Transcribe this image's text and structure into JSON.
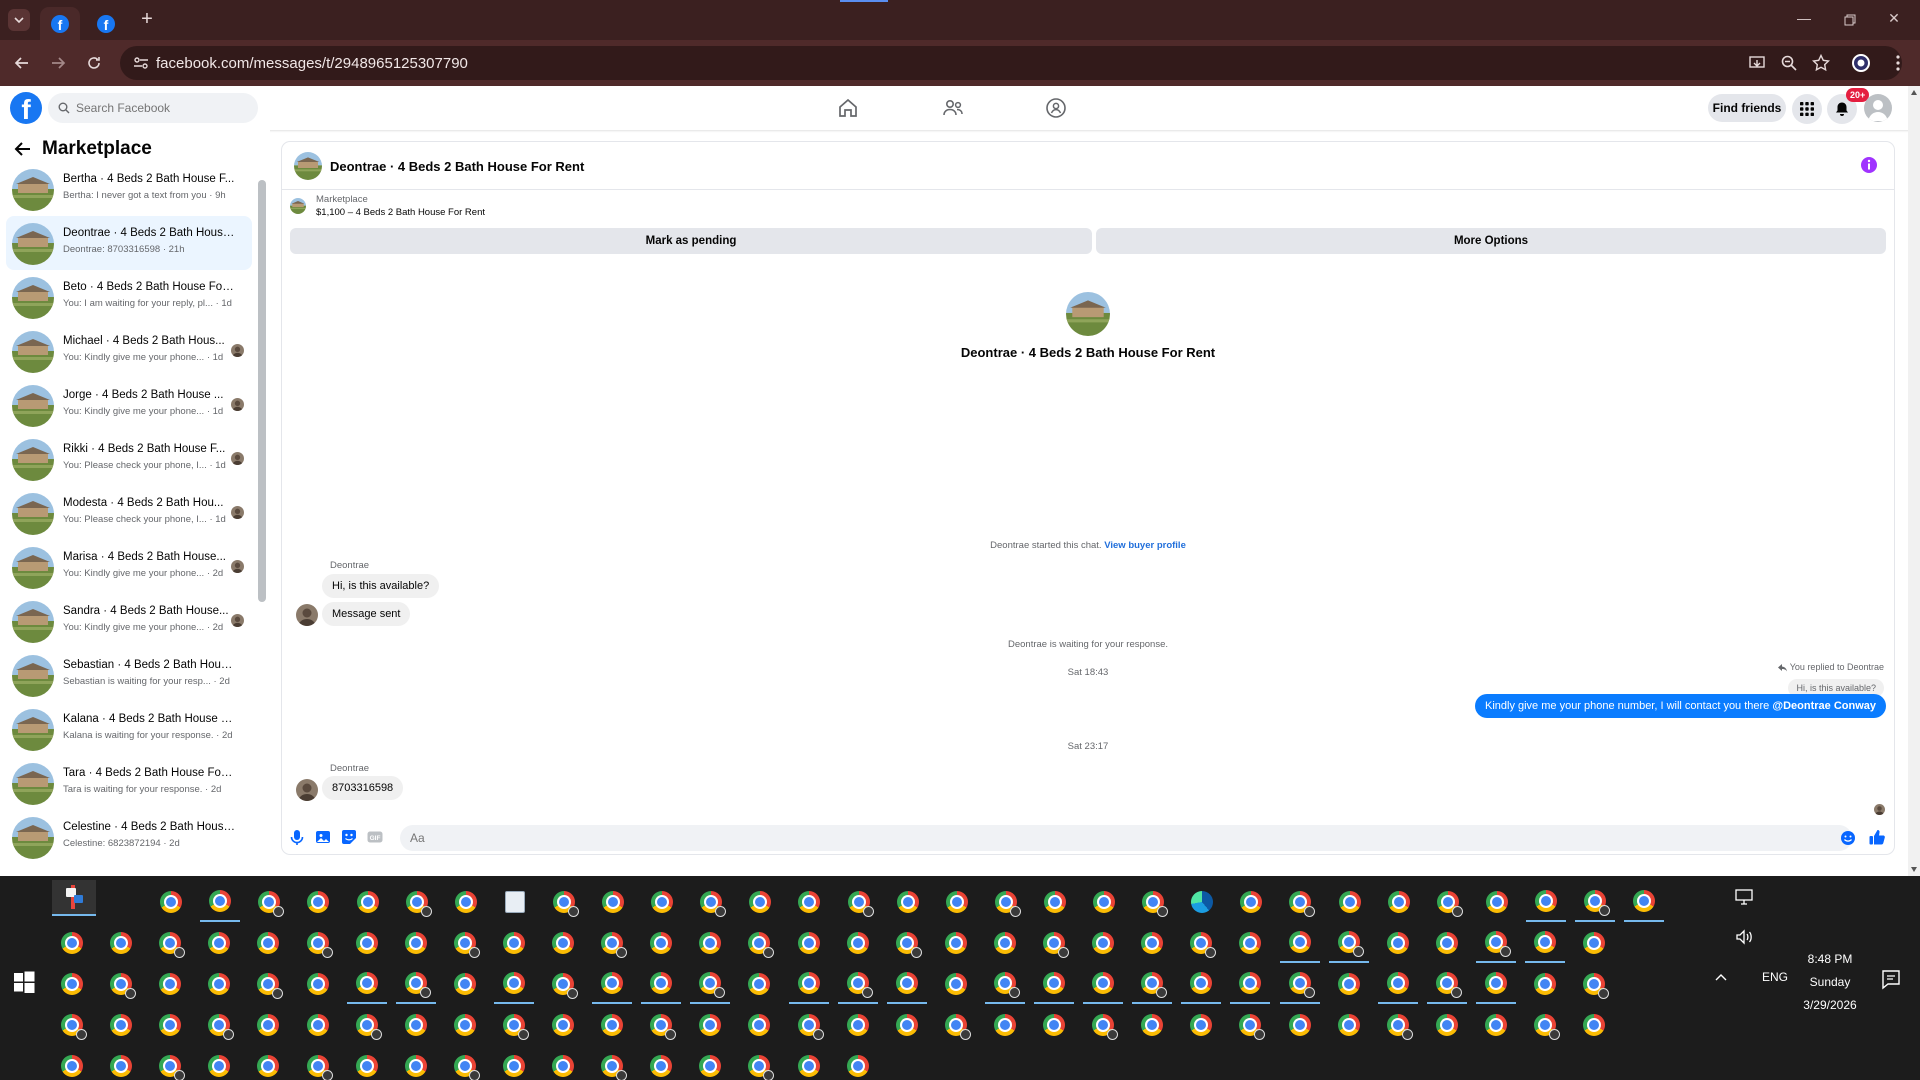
{
  "browser": {
    "url": "facebook.com/messages/t/2948965125307790",
    "tabs": [
      {
        "icon": "facebook-icon"
      },
      {
        "icon": "facebook-icon"
      }
    ]
  },
  "header": {
    "search_placeholder": "Search Facebook",
    "find_friends": "Find friends",
    "notification_badge": "20+"
  },
  "sidebar": {
    "title": "Marketplace",
    "conversations": [
      {
        "name": "Bertha · 4 Beds 2 Bath House F...",
        "preview": "Bertha: I never got a text from you · 9h",
        "active": false,
        "seen": false
      },
      {
        "name": "Deontrae · 4 Beds 2 Bath House...",
        "preview": "Deontrae: 8703316598 · 21h",
        "active": true,
        "seen": false
      },
      {
        "name": "Beto · 4 Beds 2 Bath House For ...",
        "preview": "You: I am waiting for your reply, pl... · 1d",
        "active": false,
        "seen": false
      },
      {
        "name": "Michael · 4 Beds 2 Bath Hous...",
        "preview": "You: Kindly give me your phone... · 1d",
        "active": false,
        "seen": true
      },
      {
        "name": "Jorge · 4 Beds 2 Bath House ...",
        "preview": "You: Kindly give me your phone... · 1d",
        "active": false,
        "seen": true
      },
      {
        "name": "Rikki · 4 Beds 2 Bath House F...",
        "preview": "You: Please check your phone, I... · 1d",
        "active": false,
        "seen": true
      },
      {
        "name": "Modesta · 4 Beds 2 Bath Hou...",
        "preview": "You: Please check your phone, I... · 1d",
        "active": false,
        "seen": true
      },
      {
        "name": "Marisa · 4 Beds 2 Bath House...",
        "preview": "You: Kindly give me your phone... · 2d",
        "active": false,
        "seen": true
      },
      {
        "name": "Sandra · 4 Beds 2 Bath House...",
        "preview": "You: Kindly give me your phone... · 2d",
        "active": false,
        "seen": true
      },
      {
        "name": "Sebastian · 4 Beds 2 Bath Hous...",
        "preview": "Sebastian is waiting for your resp... · 2d",
        "active": false,
        "seen": false
      },
      {
        "name": "Kalana · 4 Beds 2 Bath House F...",
        "preview": "Kalana is waiting for your response. · 2d",
        "active": false,
        "seen": false
      },
      {
        "name": "Tara · 4 Beds 2 Bath House For ...",
        "preview": "Tara is waiting for your response. · 2d",
        "active": false,
        "seen": false
      },
      {
        "name": "Celestine · 4 Beds 2 Bath House...",
        "preview": "Celestine: 6823872194 · 2d",
        "active": false,
        "seen": false
      }
    ]
  },
  "chat": {
    "title": "Deontrae · 4 Beds 2 Bath House For Rent",
    "marketplace_label": "Marketplace",
    "listing": "$1,100 – 4 Beds 2 Bath House For Rent",
    "mark_pending": "Mark as pending",
    "more_options": "More Options",
    "started_text": "Deontrae started this chat.",
    "view_profile": "View buyer profile",
    "sender_name": "Deontrae",
    "msg1": "Hi, is this available?",
    "msg2": "Message sent",
    "waiting_text": "Deontrae is waiting for your response.",
    "time1": "Sat 18:43",
    "replied_label": "You replied to Deontrae",
    "quoted_text": "Hi, is this available?",
    "my_message": "Kindly give me your phone number, I will contact you there ",
    "mention": "@Deontrae Conway",
    "time2": "Sat 23:17",
    "msg3": "8703316598",
    "composer_placeholder": "Aa"
  },
  "taskbar": {
    "language": "ENG",
    "time": "8:48 PM",
    "day": "Sunday",
    "date": "3/29/2026"
  },
  "colors": {
    "facebook_blue": "#1877f2",
    "message_blue": "#0a7cff",
    "notification_red": "#e41e3f",
    "active_row": "#ebf5ff",
    "browser_chrome": "#4f2a2a"
  }
}
